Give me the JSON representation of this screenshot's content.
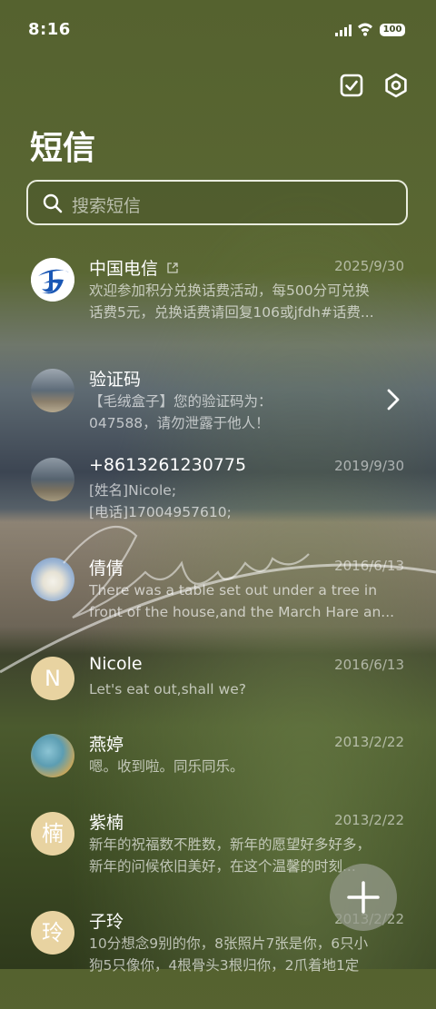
{
  "status_bar": {
    "time": "8:16",
    "battery": "100"
  },
  "header": {
    "title": "短信"
  },
  "search": {
    "placeholder": "搜索短信"
  },
  "messages": [
    {
      "name": "中国电信",
      "date": "2025/9/30",
      "preview": [
        "欢迎参加积分兑换话费活动，每500分可兑换",
        "话费5元，兑换话费请回复106或jfdh#话费..."
      ],
      "avatar": "china-telecom-logo"
    },
    {
      "name": "验证码",
      "date": "",
      "preview": [
        "【毛绒盒子】您的验证码为：",
        "047588，请勿泄露于他人！"
      ],
      "avatar": "lake-photo"
    },
    {
      "name": "+8613261230775",
      "date": "2019/9/30",
      "preview": [
        "[姓名]Nicole;",
        "[电话]17004957610;"
      ],
      "avatar": "lake-photo"
    },
    {
      "name": "倩倩",
      "date": "2016/6/13",
      "preview": [
        "There was a table set out under a tree in",
        "front of the house,and the March Hare an..."
      ],
      "avatar": "polar-bear-photo"
    },
    {
      "name": "Nicole",
      "date": "2016/6/13",
      "preview": [
        "Let's eat out,shall we?"
      ],
      "avatar_letter": "N"
    },
    {
      "name": "燕婷",
      "date": "2013/2/22",
      "preview": [
        "嗯。收到啦。同乐同乐。"
      ],
      "avatar": "painting-photo"
    },
    {
      "name": "紫楠",
      "date": "2013/2/22",
      "preview": [
        "新年的祝福数不胜数，新年的愿望好多好多，",
        "新年的问候依旧美好，在这个温馨的时刻..."
      ],
      "avatar_letter": "楠"
    },
    {
      "name": "子玲",
      "date": "2013/2/22",
      "preview": [
        "10分想念9别的你，8张照片7张是你，6只小",
        "狗5只像你，4根骨头3根归你，2爪着地1定"
      ],
      "avatar_letter": "玲"
    }
  ],
  "colors": {
    "avatar_letter_bg": "#e8d3a1",
    "fab_bg": "#9a9e8e"
  }
}
